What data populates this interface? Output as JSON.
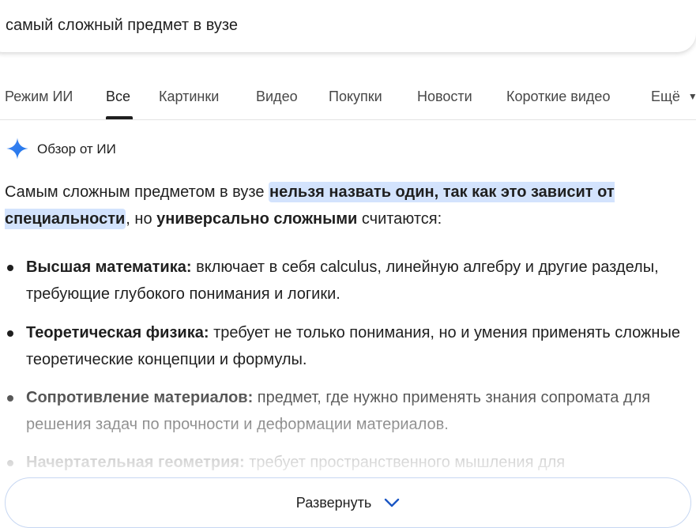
{
  "search": {
    "query": "самый сложный предмет в вузе"
  },
  "tabs": [
    {
      "label": "Режим ИИ",
      "active": false
    },
    {
      "label": "Все",
      "active": true
    },
    {
      "label": "Картинки",
      "active": false
    },
    {
      "label": "Видео",
      "active": false
    },
    {
      "label": "Покупки",
      "active": false
    },
    {
      "label": "Новости",
      "active": false
    },
    {
      "label": "Короткие видео",
      "active": false
    },
    {
      "label": "Ещё",
      "active": false
    }
  ],
  "ai_overview": {
    "title": "Обзор от ИИ",
    "intro": {
      "part1": "Самым сложным предметом в вузе ",
      "highlight": "нельзя назвать один, так как это зависит от специальности",
      "part2": ", но ",
      "bold": "универсально сложными",
      "part3": " считаются:"
    },
    "items": [
      {
        "term": "Высшая математика:",
        "text": " включает в себя calculus, линейную алгебру и другие разделы, требующие глубокого понимания и логики."
      },
      {
        "term": "Теоретическая физика:",
        "text": " требует не только понимания, но и умения применять сложные теоретические концепции и формулы."
      },
      {
        "term": "Сопротивление материалов:",
        "text": " предмет, где нужно применять знания сопромата для решения задач по прочности и деформации материалов."
      },
      {
        "term": "Начертательная геометрия:",
        "text": " требует пространственного мышления для"
      }
    ],
    "expand_label": "Развернуть"
  },
  "colors": {
    "highlight": "#d3e3fd",
    "spark_blue": "#4285f4",
    "expand_chevron": "#1a56c4"
  }
}
